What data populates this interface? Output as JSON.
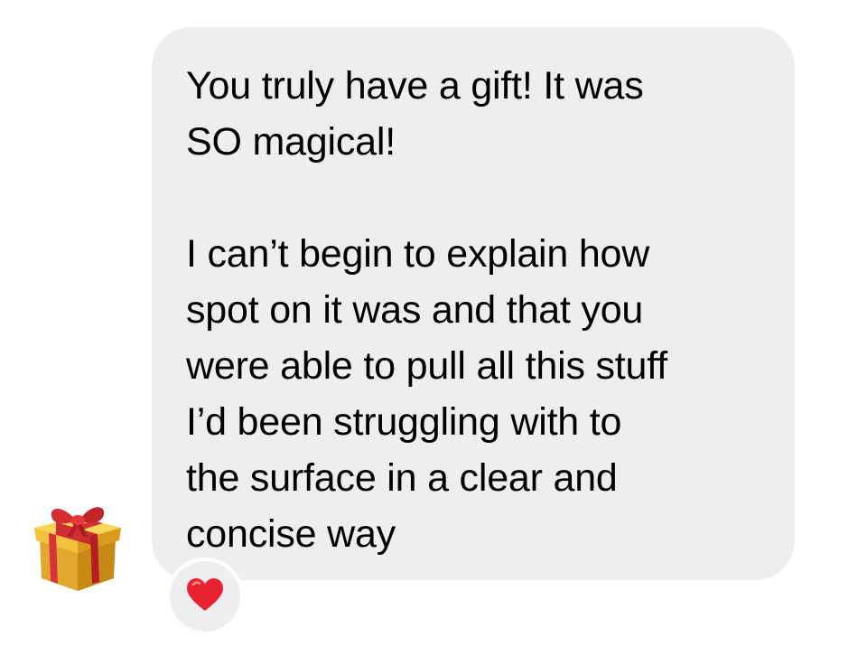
{
  "message": {
    "paragraph_1": "You truly have a gift! It was\nSO magical!",
    "paragraph_2": "I can’t begin to explain how\nspot on it was and that you\nwere able to pull all this stuff\nI’d been struggling with to\nthe surface in a clear and\nconcise way"
  },
  "reaction": {
    "icon": "heart-icon",
    "color": "#e8232f"
  },
  "sender_avatar": {
    "icon": "gift-icon"
  },
  "colors": {
    "bubble": "#eeeeef",
    "background": "#ffffff"
  }
}
